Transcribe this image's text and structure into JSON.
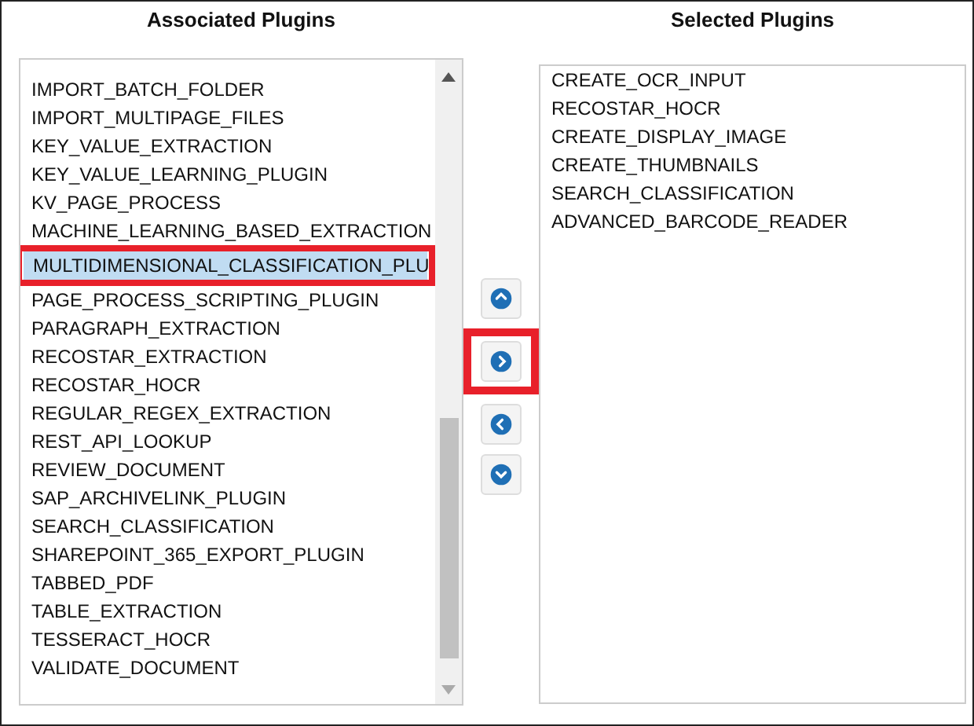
{
  "associated": {
    "title": "Associated Plugins",
    "items": [
      {
        "label": "IMPORT_BATCH_FOLDER",
        "selected": false,
        "marked": false
      },
      {
        "label": "IMPORT_MULTIPAGE_FILES",
        "selected": false,
        "marked": false
      },
      {
        "label": "KEY_VALUE_EXTRACTION",
        "selected": false,
        "marked": false
      },
      {
        "label": "KEY_VALUE_LEARNING_PLUGIN",
        "selected": false,
        "marked": false
      },
      {
        "label": "KV_PAGE_PROCESS",
        "selected": false,
        "marked": false
      },
      {
        "label": "MACHINE_LEARNING_BASED_EXTRACTION",
        "selected": false,
        "marked": false
      },
      {
        "label": "MULTIDIMENSIONAL_CLASSIFICATION_PLU",
        "selected": true,
        "marked": true
      },
      {
        "label": "PAGE_PROCESS_SCRIPTING_PLUGIN",
        "selected": false,
        "marked": false
      },
      {
        "label": "PARAGRAPH_EXTRACTION",
        "selected": false,
        "marked": false
      },
      {
        "label": "RECOSTAR_EXTRACTION",
        "selected": false,
        "marked": false
      },
      {
        "label": "RECOSTAR_HOCR",
        "selected": false,
        "marked": false
      },
      {
        "label": "REGULAR_REGEX_EXTRACTION",
        "selected": false,
        "marked": false
      },
      {
        "label": "REST_API_LOOKUP",
        "selected": false,
        "marked": false
      },
      {
        "label": "REVIEW_DOCUMENT",
        "selected": false,
        "marked": false
      },
      {
        "label": "SAP_ARCHIVELINK_PLUGIN",
        "selected": false,
        "marked": false
      },
      {
        "label": "SEARCH_CLASSIFICATION",
        "selected": false,
        "marked": false
      },
      {
        "label": "SHAREPOINT_365_EXPORT_PLUGIN",
        "selected": false,
        "marked": false
      },
      {
        "label": "TABBED_PDF",
        "selected": false,
        "marked": false
      },
      {
        "label": "TABLE_EXTRACTION",
        "selected": false,
        "marked": false
      },
      {
        "label": "TESSERACT_HOCR",
        "selected": false,
        "marked": false
      },
      {
        "label": "VALIDATE_DOCUMENT",
        "selected": false,
        "marked": false
      }
    ]
  },
  "buttons": [
    {
      "kind": "up",
      "marked": false
    },
    {
      "kind": "right",
      "marked": true
    },
    {
      "kind": "left",
      "marked": false
    },
    {
      "kind": "down",
      "marked": false
    }
  ],
  "selected": {
    "title": "Selected Plugins",
    "items": [
      {
        "label": "CREATE_OCR_INPUT",
        "selected": false
      },
      {
        "label": "RECOSTAR_HOCR",
        "selected": false
      },
      {
        "label": "CREATE_DISPLAY_IMAGE",
        "selected": false
      },
      {
        "label": "CREATE_THUMBNAILS",
        "selected": false
      },
      {
        "label": "SEARCH_CLASSIFICATION",
        "selected": false
      },
      {
        "label": "ADVANCED_BARCODE_READER",
        "selected": false
      }
    ]
  }
}
